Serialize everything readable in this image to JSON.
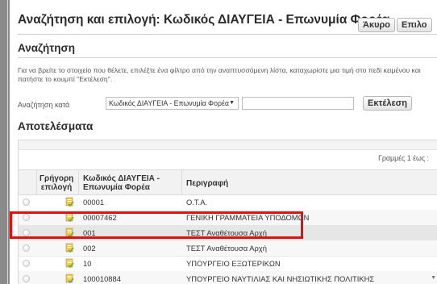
{
  "dialog": {
    "title": "Αναζήτηση και επιλογή: Κωδικός ΔΙΑΥΓΕΙΑ - Επωνυμία Φορέα",
    "cancel_label": "Άκυρο",
    "select_label": "Επιλο"
  },
  "search": {
    "section_title": "Αναζήτηση",
    "instructions": "Για να βρείτε το στοιχείο που θέλετε, επιλέξτε ένα φίλτρο από την αναπτυσσόμενη λίστα, καταχωρίστε μια τιμή στο πεδί κειμένου και πατήστε το κουμπί \"Εκτέλεση\".",
    "search_by_label": "Αναζήτηση κατά",
    "search_by_value": "Κωδικός ΔΙΑΥΓΕΙΑ - Επωνυμία Φορέα",
    "input_value": "",
    "execute_label": "Εκτέλεση"
  },
  "results": {
    "section_title": "Αποτελέσματα",
    "rows_info": "Γραμμές 1 έως :",
    "columns": {
      "quick": "Γρήγορη επιλογή",
      "code": "Κωδικός ΔΙΑΥΓΕΙΑ - Επωνυμία Φορέα",
      "description": "Περιγραφή"
    },
    "rows": [
      {
        "code": "00001",
        "description": "Ο.Τ.Α."
      },
      {
        "code": "00007462",
        "description": "ΓΕΝΙΚΗ ΓΡΑΜΜΑΤΕΙΑ ΥΠΟΔΟΜΩΝ"
      },
      {
        "code": "001",
        "description": "ΤΕΣΤ Αναθέτουσα Αρχή"
      },
      {
        "code": "002",
        "description": "ΤΕΣΤ Αναθέτουσα Αρχή"
      },
      {
        "code": "10",
        "description": "ΥΠΟΥΡΓΕΙΟ ΕΞΩΤΕΡΙΚΩΝ"
      },
      {
        "code": "100010884",
        "description": "ΥΠΟΥΡΓΕΙΟ ΝΑΥΤΙΛΙΑΣ ΚΑΙ ΝΗΣΙΩΤΙΚΗΣ ΠΟΛΙΤΙΚΗΣ"
      }
    ],
    "selected_row": 2
  },
  "colors": {
    "highlight": "#e01010",
    "selected_row_bg": "#e6e6e6",
    "icon_yellow": "#f2c94c",
    "icon_green": "#6aa84f"
  }
}
